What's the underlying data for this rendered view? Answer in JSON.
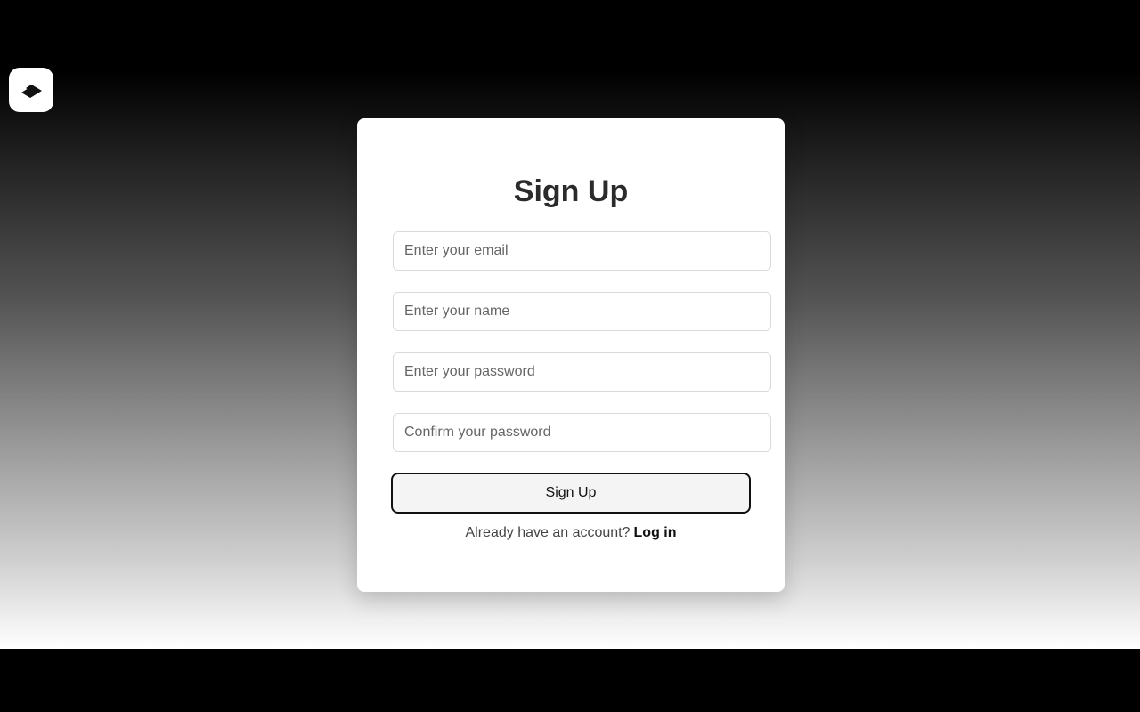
{
  "logo": {
    "icon": "ticket-icon"
  },
  "signup": {
    "title": "Sign Up",
    "email_placeholder": "Enter your email",
    "name_placeholder": "Enter your name",
    "password_placeholder": "Enter your password",
    "confirm_placeholder": "Confirm your password",
    "submit_label": "Sign Up",
    "login_prompt": "Already have an account?",
    "login_link": "Log in"
  },
  "colors": {
    "card_bg": "#ffffff",
    "button_border": "#111111",
    "button_bg": "#f4f4f4"
  }
}
